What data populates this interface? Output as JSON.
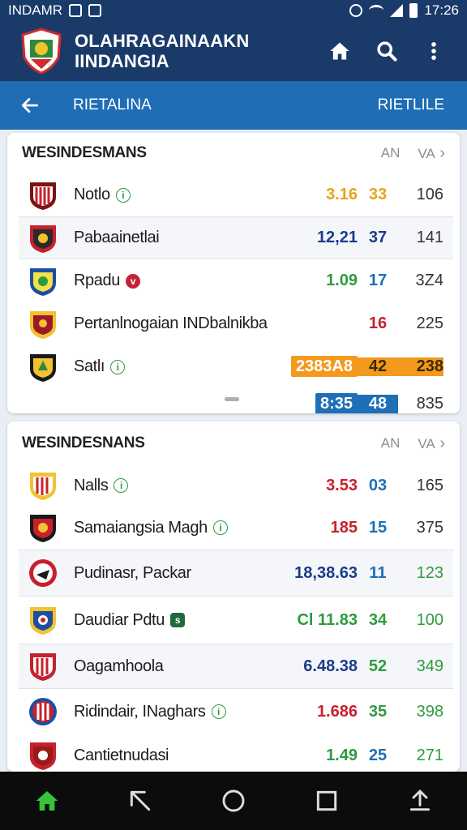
{
  "status_bar": {
    "carrier": "INDAMR",
    "time": "17:26"
  },
  "header": {
    "title_line1": "OLAHRAGAINAAKN",
    "title_line2": "IINDANGIA"
  },
  "subheader": {
    "left": "RIETALINA",
    "right": "RIETLILE"
  },
  "colors": {
    "header_bg": "#1a3b6a",
    "subheader_bg": "#1f6db4",
    "orange_pill": "#f39a1e",
    "blue_pill": "#1d6fb8",
    "nav_active": "#37c23a"
  },
  "card1": {
    "title": "WESINDESMANS",
    "col1": "AN",
    "col2": "VA",
    "rows": [
      {
        "name": "Notlo",
        "badge": "i",
        "v1": "3.16",
        "v2": "33",
        "v3": "106"
      },
      {
        "name": "Pabaainetlai",
        "badge": "",
        "v1": "12,21",
        "v2": "37",
        "v3": "141"
      },
      {
        "name": "Rpadu",
        "badge": "v",
        "v1": "1.09",
        "v2": "17",
        "v3": "3Z4"
      },
      {
        "name": "Pertanlnogaian INDbalnikba",
        "badge": "",
        "v1": "",
        "v2": "16",
        "v3": "225"
      },
      {
        "name": "Satlı",
        "badge": "i",
        "v1": "2383A8",
        "v2": "42",
        "v3": "238"
      },
      {
        "name": "",
        "badge": "",
        "v1": "8:35",
        "v2": "48",
        "v3": "835"
      }
    ]
  },
  "card2": {
    "title": "WESINDESNANS",
    "col1": "AN",
    "col2": "VA",
    "rows": [
      {
        "name": "Nalls",
        "badge": "i",
        "v1": "3.53",
        "v2": "03",
        "v3": "165"
      },
      {
        "name": "Samaiangsia Magh",
        "badge": "i",
        "v1": "185",
        "v2": "15",
        "v3": "375"
      },
      {
        "name": "Pudinasr, Packar",
        "badge": "",
        "v1": "18,38.63",
        "v2": "11",
        "v3": "123"
      },
      {
        "name": "Daudiar Pdtu",
        "badge": "s",
        "v1": "Cl 11.83",
        "v2": "34",
        "v3": "100"
      },
      {
        "name": "Oagamhoola",
        "badge": "",
        "v1": "6.48.38",
        "v2": "52",
        "v3": "349"
      },
      {
        "name": "Ridindair, INaghars",
        "badge": "i",
        "v1": "1.686",
        "v2": "35",
        "v3": "398"
      },
      {
        "name": "Cantietnudasi",
        "badge": "",
        "v1": "1.49",
        "v2": "25",
        "v3": "271"
      }
    ]
  },
  "nav": {
    "home_icon": "home-icon",
    "back_icon": "back-gesture-icon",
    "circle_icon": "home-circle-icon",
    "square_icon": "recents-icon",
    "share_icon": "share-icon"
  }
}
